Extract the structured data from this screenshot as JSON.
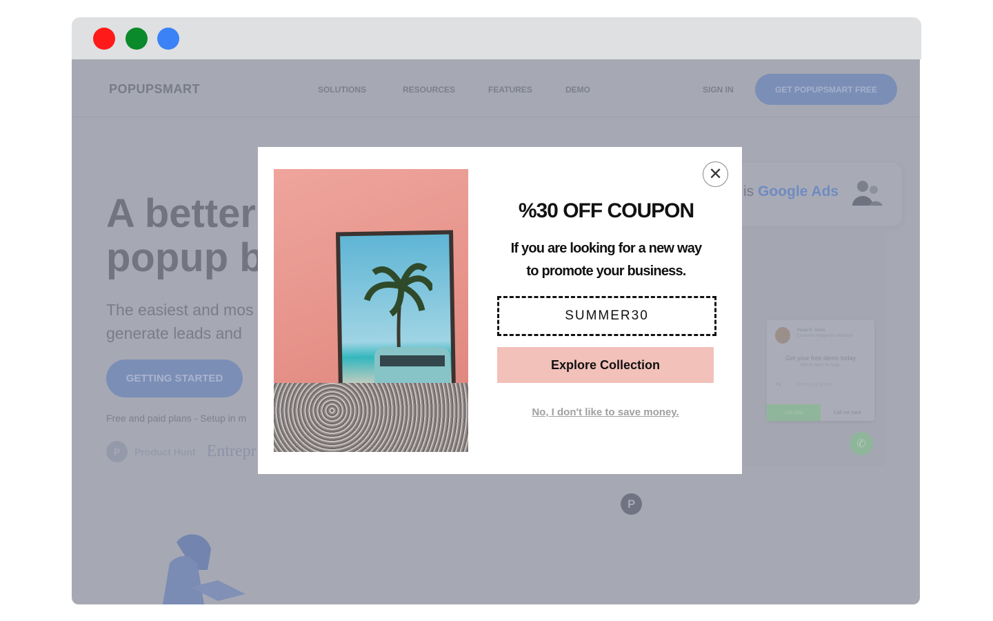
{
  "window": {
    "controls": [
      {
        "name": "close",
        "color": "#ff1a1a"
      },
      {
        "name": "minimize",
        "color": "#0a8a2a"
      },
      {
        "name": "maximize",
        "color": "#3b82f6"
      }
    ]
  },
  "nav": {
    "logo": "POPUPSMART",
    "items": [
      "SOLUTIONS",
      "RESOURCES",
      "FEATURES",
      "DEMO"
    ],
    "sign_in": "SIGN IN",
    "cta": "GET POPUPSMART FREE"
  },
  "hero": {
    "line1": "A better",
    "line2": "popup b",
    "sub1": "The easiest and mos",
    "sub2": "generate leads and",
    "button": "GETTING STARTED",
    "plans": "Free and paid plans - Setup in m",
    "product_hunt": "Product Hunt",
    "entrepreneur": "Entrepr",
    "ph_letter": "P"
  },
  "google_card": {
    "prefix": "is",
    "highlight": "Google Ads"
  },
  "demo_widget": {
    "name": "Paula R. Jones",
    "role": "Customer Happiness Manager",
    "title": "Get your free demo today",
    "subtitle": "We're here to help.",
    "country_code": "+1",
    "phone_placeholder": "Enter your phone",
    "call_now": "Call Now",
    "call_back": "Call me back"
  },
  "center_logo": "P",
  "popup": {
    "title": "%30 OFF COUPON",
    "desc_line1": "If you are looking for a new way",
    "desc_line2": "to promote your business.",
    "coupon_code": "SUMMER30",
    "button": "Explore Collection",
    "decline": "No, I don't like to save money.",
    "close_symbol": "✕",
    "accent": "#f2c1ba"
  }
}
